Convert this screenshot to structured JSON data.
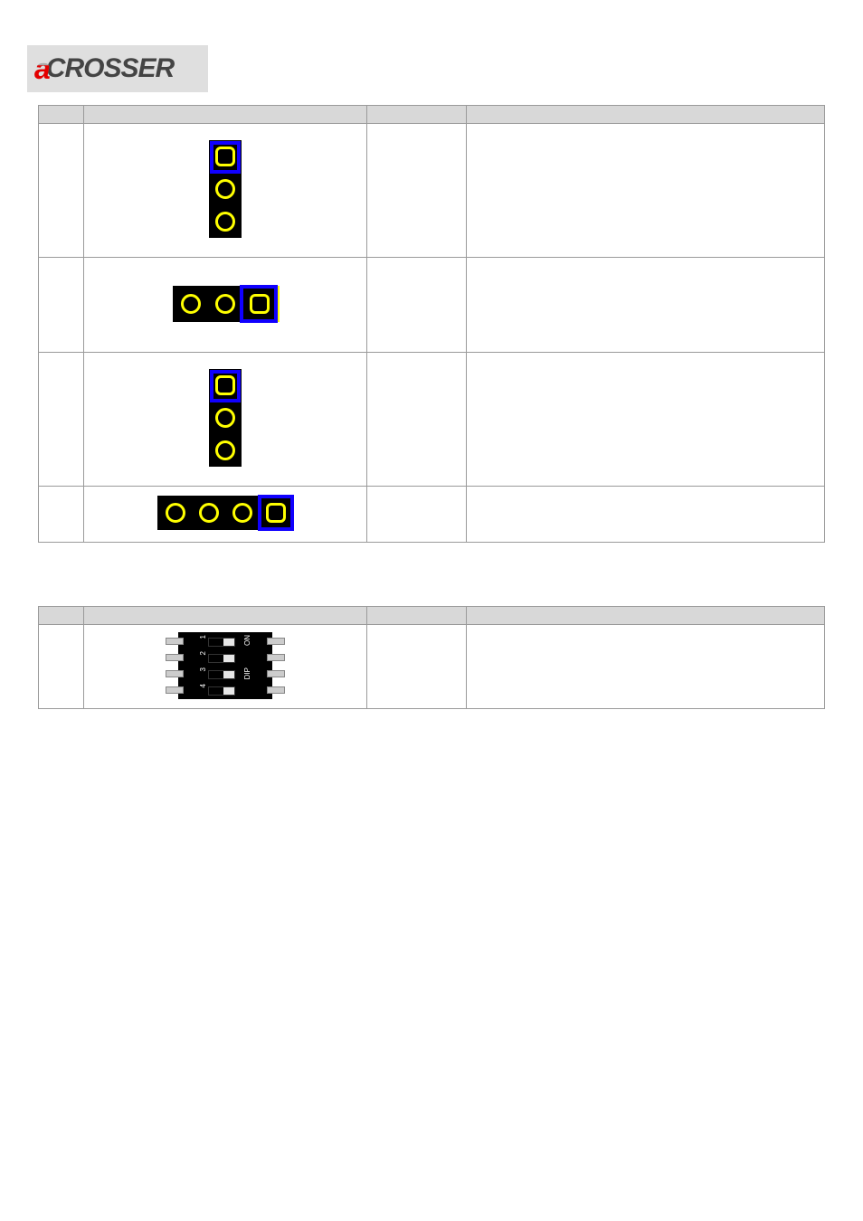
{
  "logo": {
    "a": "a",
    "text": "CROSSER"
  },
  "table1": {
    "headers": [
      "",
      "",
      "",
      ""
    ],
    "rows": [
      {
        "label": "",
        "setting": "",
        "desc": "",
        "jumper": "jv3"
      },
      {
        "label": "",
        "setting": "",
        "desc": "",
        "jumper": "jh3"
      },
      {
        "label": "",
        "setting": "",
        "desc": "",
        "jumper": "jv3"
      },
      {
        "label": "",
        "setting": "",
        "desc": "",
        "jumper": "jh4"
      }
    ]
  },
  "table2": {
    "headers": [
      "",
      "",
      "",
      ""
    ],
    "rows": [
      {
        "label": "",
        "setting": "",
        "desc": "",
        "dip": {
          "on": "ON",
          "dip": "DIP",
          "nums": [
            "1",
            "2",
            "3",
            "4"
          ]
        }
      }
    ]
  }
}
